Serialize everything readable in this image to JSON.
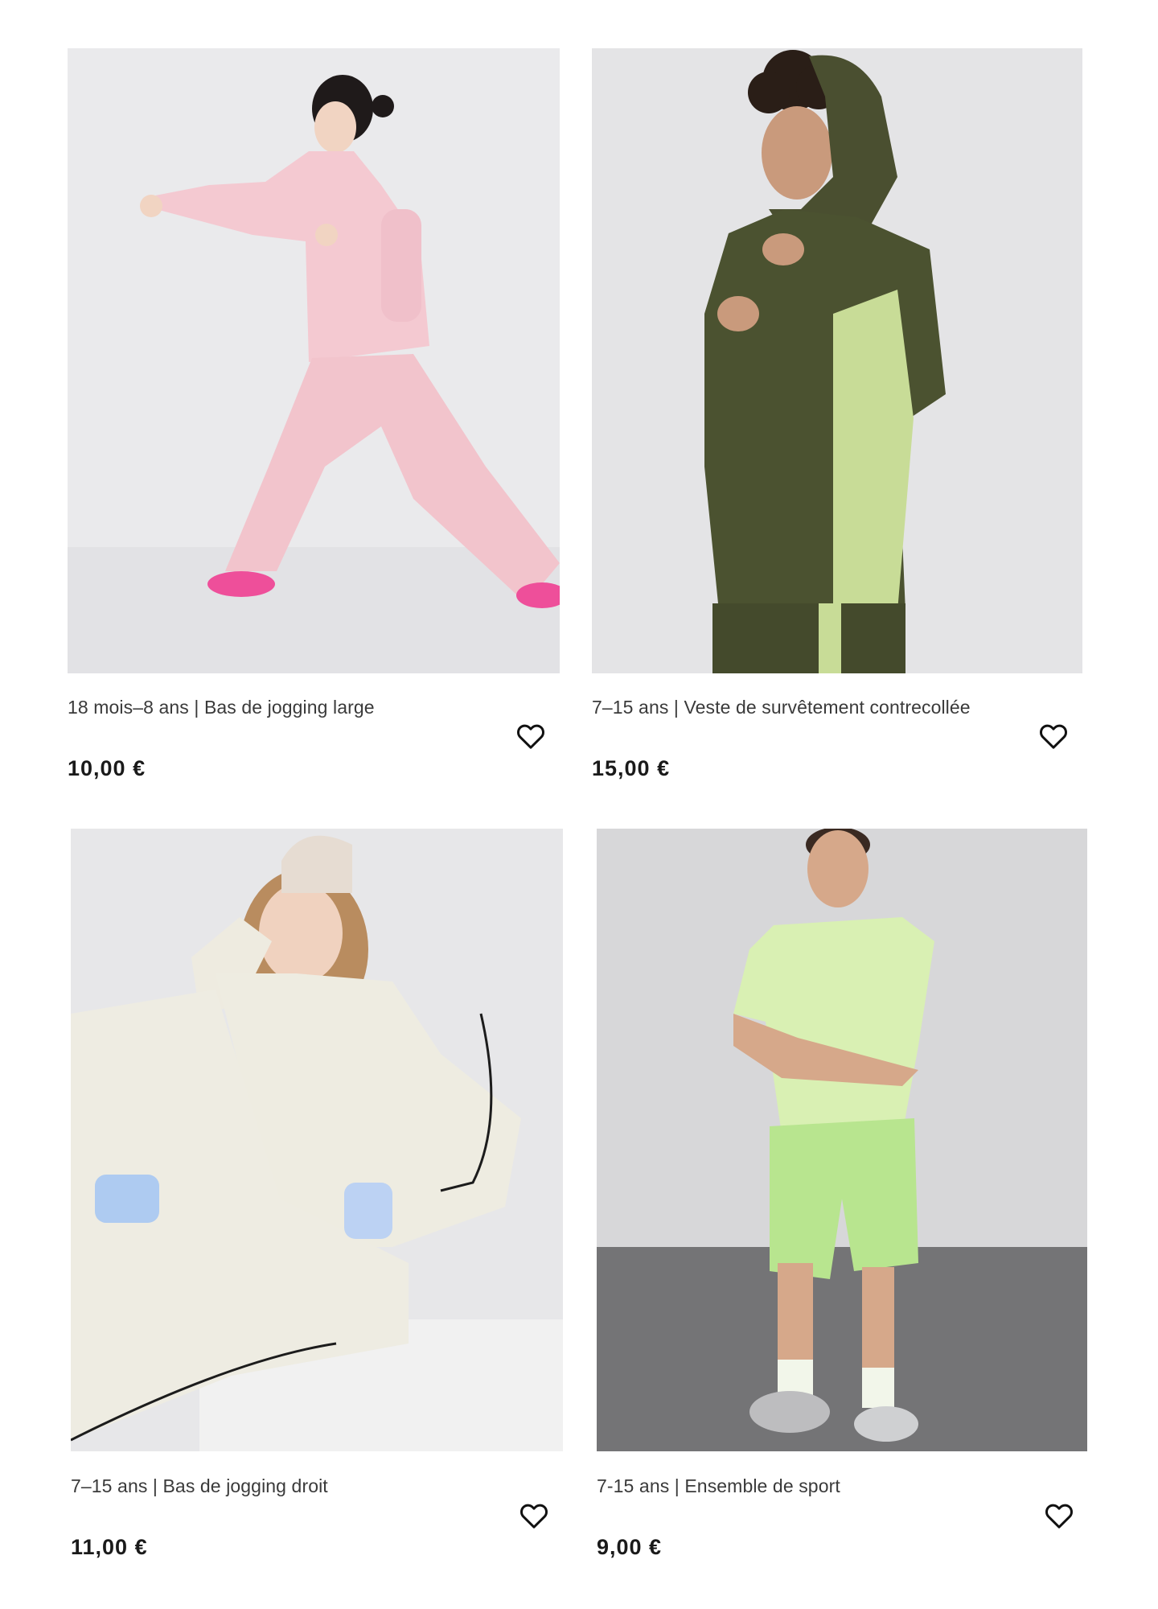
{
  "products": [
    {
      "title": "18 mois–8 ans | Bas de jogging large",
      "price": "10,00 €",
      "image_alt": "Enfant en bas de jogging large rose",
      "favorite_icon": "heart-icon"
    },
    {
      "title": "7–15 ans | Veste de survêtement contrecollée",
      "price": "15,00 €",
      "image_alt": "Enfant en veste de survêtement kaki et vert",
      "favorite_icon": "heart-icon"
    },
    {
      "title": "7–15 ans | Bas de jogging droit",
      "price": "11,00 €",
      "image_alt": "Enfant en bas de jogging droit crème",
      "favorite_icon": "heart-icon"
    },
    {
      "title": "7-15 ans | Ensemble de sport",
      "price": "9,00 €",
      "image_alt": "Enfant en ensemble de sport vert clair",
      "favorite_icon": "heart-icon"
    }
  ],
  "colors": {
    "text": "#3a3a3a",
    "price": "#1a1a1a",
    "photo_bg": "#e9e9eb"
  }
}
